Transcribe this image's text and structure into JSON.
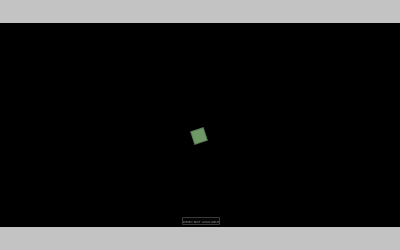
{
  "colors": {
    "frame": "#c3c3c3",
    "viewport": "#000000",
    "square": "#6f9a68",
    "status_border": "#3a3a3a",
    "status_text": "#9a9a9a"
  },
  "shape": {
    "icon": "green-square",
    "rotation_deg": -18
  },
  "status": {
    "label": "DEMO NOT AVAILABLE"
  }
}
